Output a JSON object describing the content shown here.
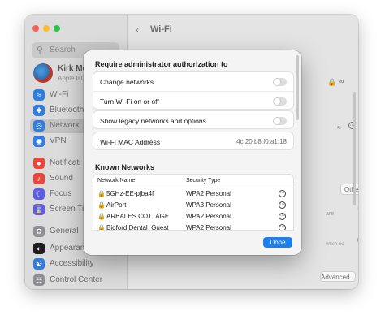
{
  "window": {
    "title": "Wi-Fi"
  },
  "sidebar": {
    "search_placeholder": "Search",
    "account": {
      "name": "Kirk McE",
      "subtitle": "Apple ID"
    },
    "items": [
      {
        "label": "Wi-Fi",
        "icon": "wifi-icon",
        "color": "#2f7de1"
      },
      {
        "label": "Bluetooth",
        "icon": "bluetooth-icon",
        "color": "#2f7de1"
      },
      {
        "label": "Network",
        "icon": "globe-icon",
        "color": "#2f7de1"
      },
      {
        "label": "VPN",
        "icon": "vpn-icon",
        "color": "#2f7de1"
      },
      {
        "label": "Notificati",
        "icon": "bell-icon",
        "color": "#e8463a"
      },
      {
        "label": "Sound",
        "icon": "speaker-icon",
        "color": "#e8463a"
      },
      {
        "label": "Focus",
        "icon": "moon-icon",
        "color": "#5e5ce6"
      },
      {
        "label": "Screen Tim",
        "icon": "hourglass-icon",
        "color": "#5e5ce6"
      },
      {
        "label": "General",
        "icon": "gear-icon",
        "color": "#8e8e93"
      },
      {
        "label": "Appearanc",
        "icon": "appearance-icon",
        "color": "#1d1d1f"
      },
      {
        "label": "Accessibility",
        "icon": "accessibility-icon",
        "color": "#2f7de1"
      },
      {
        "label": "Control Center",
        "icon": "control-center-icon",
        "color": "#8e8e93"
      }
    ],
    "active_index": 2
  },
  "main": {
    "other_button": "Other...",
    "advanced_button": "Advanced...",
    "help_button": "?",
    "frag_1": "are",
    "frag_2": "when no"
  },
  "dialog": {
    "admin_heading": "Require administrator authorization to",
    "admin_rows": [
      {
        "label": "Change networks",
        "on": false
      },
      {
        "label": "Turn Wi-Fi on or off",
        "on": false
      }
    ],
    "legacy_row": {
      "label": "Show legacy networks and options",
      "on": false
    },
    "mac_row": {
      "label": "Wi-Fi MAC Address",
      "value": "4c:20:b8:f0:a1:18"
    },
    "known_heading": "Known Networks",
    "table": {
      "columns": [
        "Network Name",
        "Security Type"
      ],
      "rows": [
        {
          "name": "5GHz-EE-pjba4f",
          "security": "WPA2 Personal"
        },
        {
          "name": "AirPort",
          "security": "WPA3 Personal"
        },
        {
          "name": "ARBALES COTTAGE",
          "security": "WPA2 Personal"
        },
        {
          "name": "Bidford Dental_Guest",
          "security": "WPA2 Personal"
        }
      ]
    },
    "done_label": "Done",
    "accent": "#1e80f0"
  }
}
